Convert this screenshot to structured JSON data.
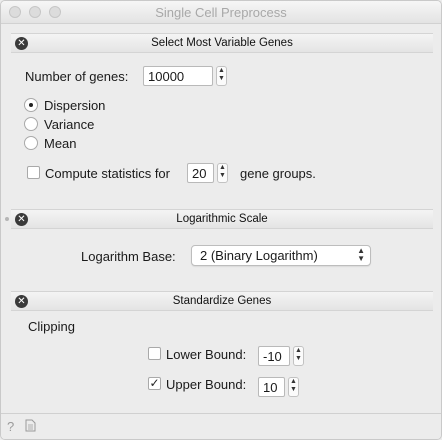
{
  "window": {
    "title": "Single Cell Preprocess"
  },
  "sections": {
    "variable_genes": {
      "title": "Select Most Variable Genes",
      "num_genes_label": "Number of genes:",
      "num_genes_value": "10000",
      "methods": [
        {
          "label": "Dispersion",
          "checked": true
        },
        {
          "label": "Variance",
          "checked": false
        },
        {
          "label": "Mean",
          "checked": false
        }
      ],
      "compute_stats_label": "Compute statistics for",
      "compute_stats_checked": false,
      "gene_groups_value": "20",
      "gene_groups_suffix": "gene groups."
    },
    "log_scale": {
      "title": "Logarithmic Scale",
      "base_label": "Logarithm Base:",
      "base_value": "2 (Binary Logarithm)"
    },
    "standardize": {
      "title": "Standardize Genes",
      "clipping_label": "Clipping",
      "lower_label": "Lower Bound:",
      "lower_checked": false,
      "lower_value": "-10",
      "upper_label": "Upper Bound:",
      "upper_checked": true,
      "upper_value": "10"
    }
  },
  "icons": {
    "close": "close-icon",
    "stepper": "stepper-icon",
    "chevron": "chevron-updown-icon",
    "help": "help-icon",
    "report": "document-icon"
  }
}
